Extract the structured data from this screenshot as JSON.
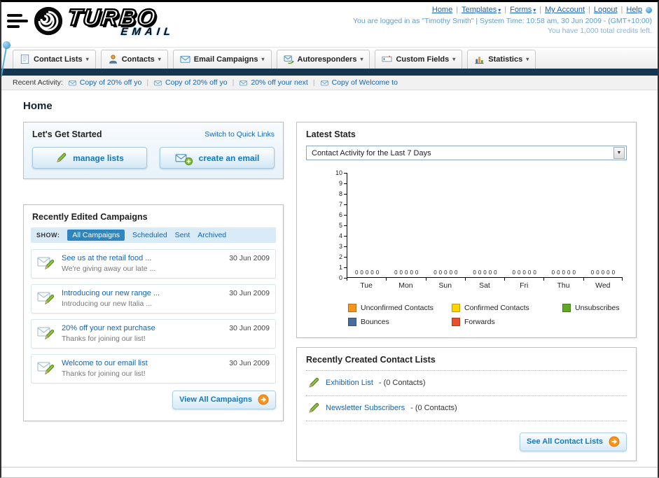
{
  "colors": {
    "accent_orange": "#F7941E",
    "link_blue": "#1464B4",
    "navy_bar": "#16364F"
  },
  "icons": {
    "chevron_down": "▾",
    "select_caret": "▼"
  },
  "header": {
    "logo": {
      "word": "TURBO",
      "sub": "EMAIL"
    },
    "nav_items": [
      "Home",
      "Templates",
      "Forms",
      "My Account",
      "Logout",
      "Help"
    ],
    "login_text": "You are logged in as \"Timothy Smith\" | System Time: 10:58 am, 30 Jun 2009 - (GMT+10:00)",
    "credits_text": "You have 1,000 total credits left."
  },
  "tabs": [
    {
      "label": "Contact Lists"
    },
    {
      "label": "Contacts"
    },
    {
      "label": "Email Campaigns"
    },
    {
      "label": "Autoresponders"
    },
    {
      "label": "Custom Fields"
    },
    {
      "label": "Statistics"
    }
  ],
  "recent_activity": {
    "label": "Recent Activity:",
    "items": [
      "Copy of 20% off yo",
      "Copy of 20% off yo",
      "20% off your next",
      "Copy of Welcome to"
    ]
  },
  "page_title": "Home",
  "get_started": {
    "title": "Let's Get Started",
    "switch_link": "Switch to Quick Links",
    "manage_lists_label": "manage lists",
    "create_email_label": "create an email"
  },
  "campaigns": {
    "title": "Recently Edited Campaigns",
    "show_label": "SHOW:",
    "filters": [
      "All Campaigns",
      "Scheduled",
      "Sent",
      "Archived"
    ],
    "items": [
      {
        "title": "See us at the retail food ...",
        "subtitle": "We're giving away our late ...",
        "date": "30 Jun 2009"
      },
      {
        "title": "Introducing our new range ...",
        "subtitle": "Introducing our new Italia ...",
        "date": "30 Jun 2009"
      },
      {
        "title": "20% off your next purchase",
        "subtitle": "Thanks for joining our list!",
        "date": "30 Jun 2009"
      },
      {
        "title": "Welcome to our email list",
        "subtitle": "Thanks for joining our list!",
        "date": "30 Jun 2009"
      }
    ],
    "view_all_label": "View All Campaigns"
  },
  "stats": {
    "title": "Latest Stats",
    "dropdown_value": "Contact Activity for the Last 7 Days",
    "chart_data": {
      "type": "bar",
      "title": "Contact Activity for the Last 7 Days",
      "categories": [
        "Tue",
        "Mon",
        "Sun",
        "Sat",
        "Fri",
        "Thu",
        "Wed"
      ],
      "series": [
        {
          "name": "Unconfirmed Contacts",
          "color": "#F7941E",
          "values": [
            0,
            0,
            0,
            0,
            0,
            0,
            0
          ]
        },
        {
          "name": "Confirmed Contacts",
          "color": "#FFD400",
          "values": [
            0,
            0,
            0,
            0,
            0,
            0,
            0
          ]
        },
        {
          "name": "Unsubscribes",
          "color": "#61A823",
          "values": [
            0,
            0,
            0,
            0,
            0,
            0,
            0
          ]
        },
        {
          "name": "Bounces",
          "color": "#4A6B9D",
          "values": [
            0,
            0,
            0,
            0,
            0,
            0,
            0
          ]
        },
        {
          "name": "Forwards",
          "color": "#E8502D",
          "values": [
            0,
            0,
            0,
            0,
            0,
            0,
            0
          ]
        }
      ],
      "ylim": [
        0,
        10
      ],
      "ytick_step": 1,
      "grid": false,
      "legend_position": "bottom"
    }
  },
  "contact_lists": {
    "title": "Recently Created Contact Lists",
    "items": [
      {
        "name": "Exhibition List",
        "suffix": "- (0 Contacts)"
      },
      {
        "name": "Newsletter Subscribers",
        "suffix": "- (0 Contacts)"
      }
    ],
    "see_all_label": "See All Contact Lists"
  }
}
